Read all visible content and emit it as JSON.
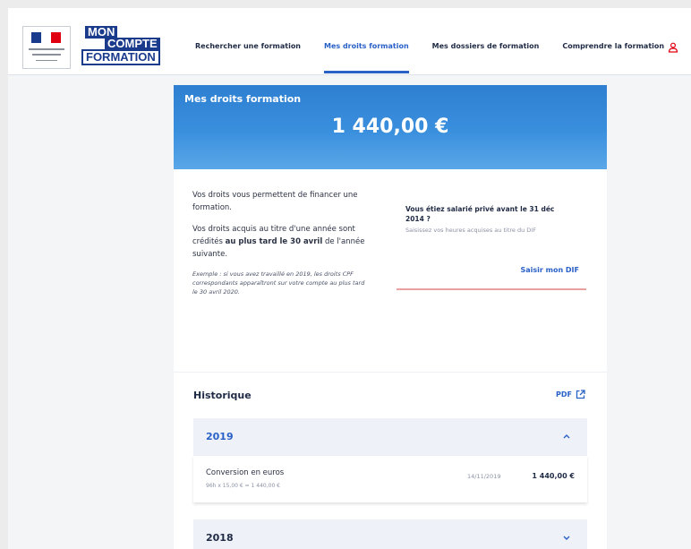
{
  "header": {
    "logo_lines": [
      "MON",
      "COMPTE",
      "FORMATION"
    ],
    "nav": [
      "Rechercher une formation",
      "Mes droits formation",
      "Mes dossiers de formation",
      "Comprendre la formation"
    ],
    "active_nav": "Mes droits formation",
    "user_icon": "user-icon"
  },
  "hero": {
    "label": "Mes droits formation",
    "amount": "1 440,00 €"
  },
  "info": {
    "p1": "Vos droits vous permettent de financer une formation.",
    "p2_a": "Vos droits acquis au titre d'une année sont crédités ",
    "p2_bold": "au plus tard le 30 avril",
    "p2_b": " de l'année suivante.",
    "example": "Exemple : si vous avez travaillé en 2019, les droits CPF correspondants apparaîtront sur votre compte au plus tard le 30 avril 2020."
  },
  "dif": {
    "title": "Vous étiez salarié privé avant le 31 déc 2014 ?",
    "subtitle": "Saisissez vos heures acquises au titre du DIF",
    "link": "Saisir mon DIF"
  },
  "history": {
    "title": "Historique",
    "pdf_label": "PDF",
    "years": [
      {
        "year": "2019",
        "expanded": true,
        "entries": [
          {
            "label": "Conversion en euros",
            "detail": "96h x 15,00 € = 1 440,00 €",
            "date": "14/11/2019",
            "amount": "1 440,00 €"
          }
        ]
      },
      {
        "year": "2018",
        "expanded": false
      }
    ]
  },
  "colors": {
    "accent": "#2a61c7",
    "brand": "#1a3a8c",
    "hero_top": "#2e7fd1",
    "hero_bottom": "#5aa7e8"
  }
}
